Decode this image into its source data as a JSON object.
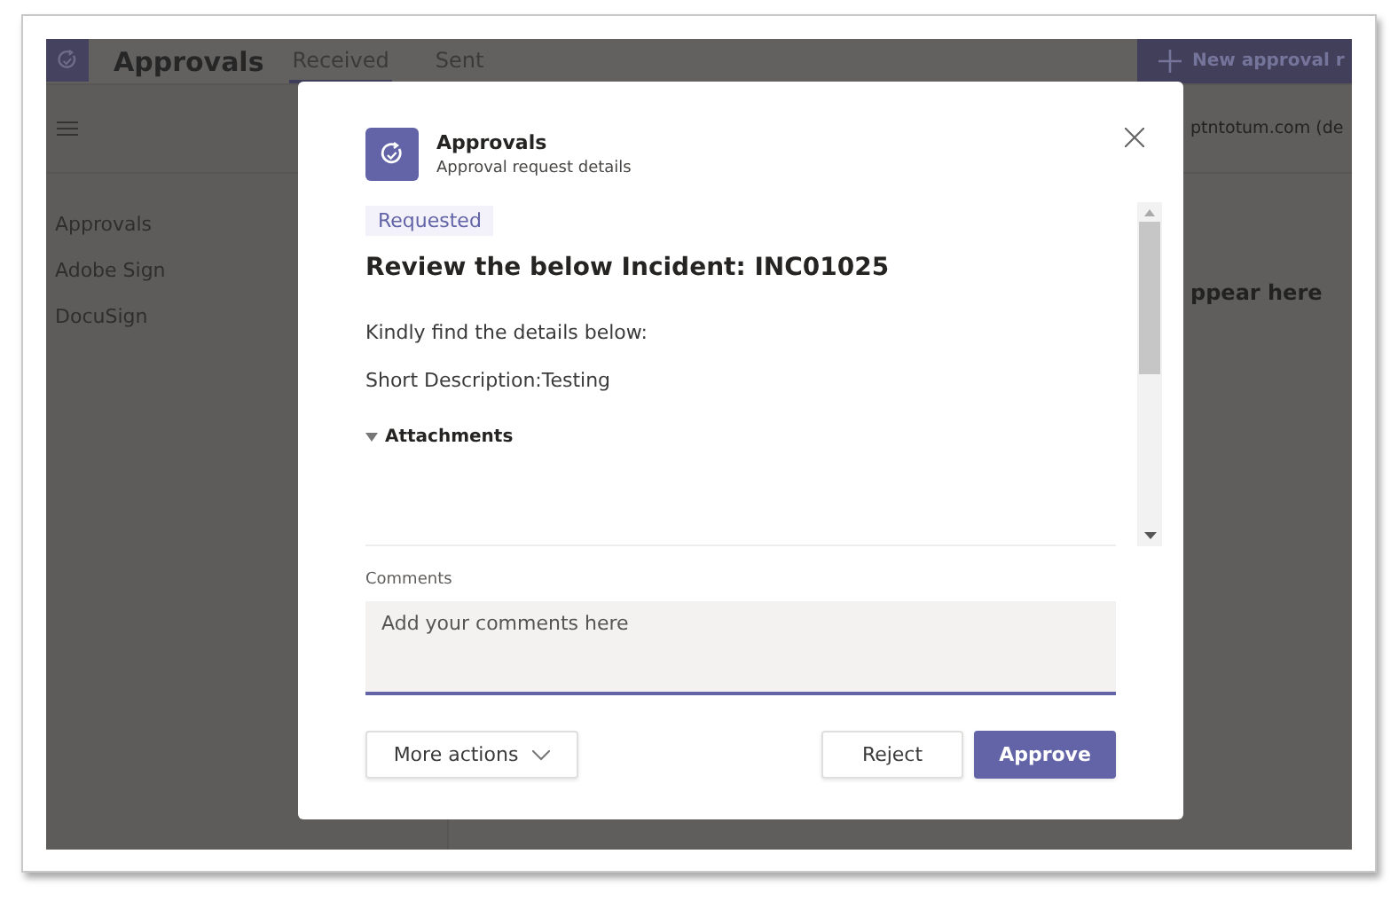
{
  "app": {
    "title": "Approvals",
    "tabs": [
      {
        "label": "Received",
        "selected": true
      },
      {
        "label": "Sent",
        "selected": false
      }
    ],
    "new_button": "New approval r",
    "account": "ptntotum.com (de",
    "sidebar": {
      "items": [
        {
          "label": "Approvals"
        },
        {
          "label": "Adobe Sign"
        },
        {
          "label": "DocuSign"
        }
      ]
    },
    "empty_text": "ppear here"
  },
  "dialog": {
    "app_name": "Approvals",
    "subtitle": "Approval request details",
    "status": "Requested",
    "heading": "Review the below Incident: INC01025",
    "paragraphs": [
      "Kindly find the details below:",
      "Short Description:Testing"
    ],
    "attachments": {
      "label": "Attachments",
      "expanded": true
    },
    "comments": {
      "label": "Comments",
      "placeholder": "Add your comments here"
    },
    "buttons": [
      {
        "label": "More actions",
        "kind": "menu"
      },
      {
        "label": "Reject",
        "kind": "secondary"
      },
      {
        "label": "Approve",
        "kind": "primary"
      }
    ]
  }
}
